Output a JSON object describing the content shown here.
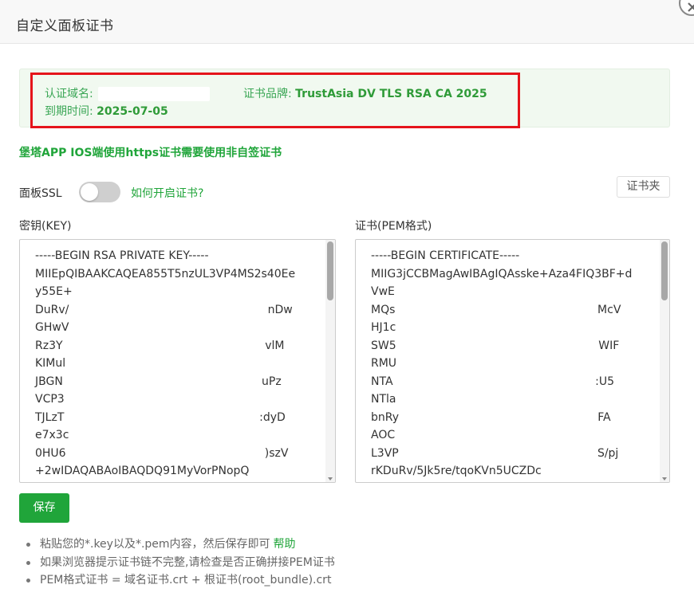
{
  "dialog": {
    "title": "自定义面板证书"
  },
  "cert_info": {
    "domain_label": "认证域名:",
    "domain_value": "",
    "brand_label": "证书品牌:",
    "brand_value": "TrustAsia DV TLS RSA CA 2025",
    "expire_label": "到期时间:",
    "expire_value": "2025-07-05"
  },
  "notice": "堡塔APP IOS端使用https证书需要使用非自签证书",
  "ssl": {
    "label": "面板SSL",
    "enabled": false,
    "howto_link": "如何开启证书?",
    "cert_folder_button": "证书夹"
  },
  "key": {
    "label": "密钥(KEY)",
    "lines": [
      "-----BEGIN RSA PRIVATE KEY-----",
      "MIIEpQIBAAKCAQEA855T5nzUL3VP4MS2s40Ee",
      "y55E+",
      "DuRv/                                                        nDw",
      "GHwV",
      "Rz3Y                                                         vlM",
      "KIMul",
      "JBGN                                                        uPz",
      "VCP3",
      "TJLzT                                                       :dyD",
      "e7x3c",
      "0HU6                                                        )szV",
      "+2wIDAQABAoIBAQDQ91MyVorPNopQ"
    ]
  },
  "pem": {
    "label": "证书(PEM格式)",
    "lines": [
      "-----BEGIN CERTIFICATE-----",
      "MIIG3jCCBMagAwIBAgIQAsske+Aza4FIQ3BF+d",
      "VwE",
      "MQs                                                         McV",
      "HJ1c",
      "SW5                                                         WIF",
      "RMU",
      "NTA                                                         :U5",
      "NTla",
      "bnRy                                                        FA",
      "AOC",
      "L3VP                                                        S/pj",
      "rKDuRv/5Jk5re/tqoKVn5UCZDc"
    ]
  },
  "save_button": "保存",
  "tips": [
    "粘贴您的*.key以及*.pem内容，然后保存即可",
    "如果浏览器提示证书链不完整,请检查是否正确拼接PEM证书",
    "PEM格式证书 = 域名证书.crt + 根证书(root_bundle).crt"
  ],
  "help_link": "帮助",
  "colors": {
    "accent": "#20a53a",
    "highlight_frame": "#e5141b",
    "info_bg": "#f1f9f0"
  }
}
